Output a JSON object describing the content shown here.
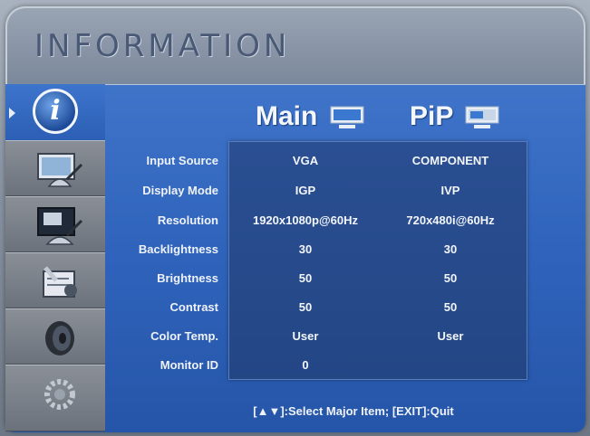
{
  "title": "INFORMATION",
  "columns": {
    "main": "Main",
    "pip": "PiP"
  },
  "rows": [
    {
      "label": "Input Source",
      "main": "VGA",
      "pip": "COMPONENT"
    },
    {
      "label": "Display Mode",
      "main": "IGP",
      "pip": "IVP"
    },
    {
      "label": "Resolution",
      "main": "1920x1080p@60Hz",
      "pip": "720x480i@60Hz"
    },
    {
      "label": "Backlightness",
      "main": "30",
      "pip": "30"
    },
    {
      "label": "Brightness",
      "main": "50",
      "pip": "50"
    },
    {
      "label": "Contrast",
      "main": "50",
      "pip": "50"
    },
    {
      "label": "Color Temp.",
      "main": "User",
      "pip": "User"
    },
    {
      "label": "Monitor ID",
      "main": "0",
      "pip": ""
    }
  ],
  "footer": "[▲▼]:Select Major Item; [EXIT]:Quit",
  "sidebar": [
    {
      "icon": "info-icon",
      "active": true
    },
    {
      "icon": "picture-settings-icon",
      "active": false
    },
    {
      "icon": "pip-settings-icon",
      "active": false
    },
    {
      "icon": "tools-settings-icon",
      "active": false
    },
    {
      "icon": "audio-speaker-icon",
      "active": false
    },
    {
      "icon": "gear-settings-icon",
      "active": false
    }
  ],
  "colors": {
    "panel": "#2f63bb",
    "table": "#234685",
    "text": "#f3f6fb"
  }
}
